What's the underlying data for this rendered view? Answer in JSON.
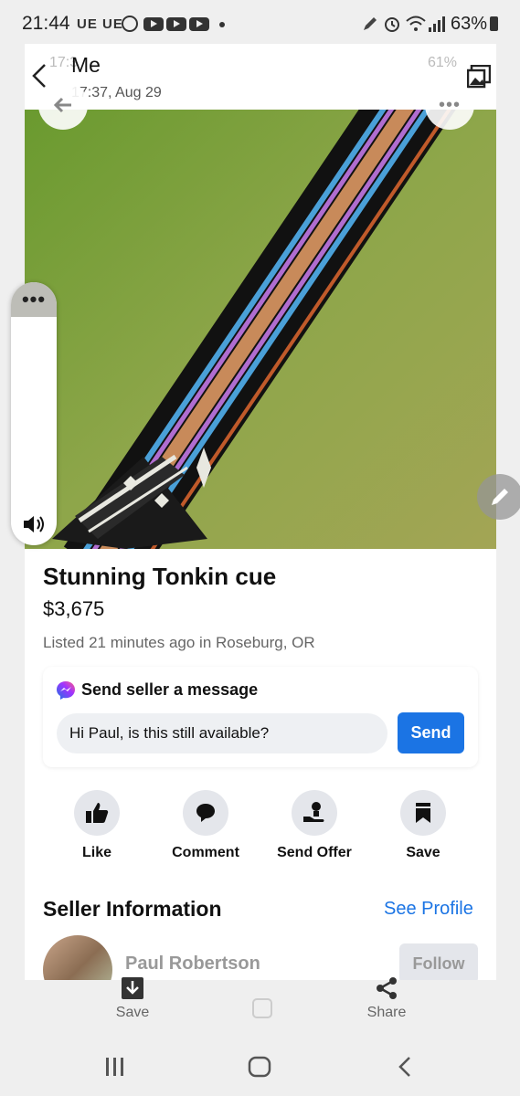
{
  "status_bar": {
    "time": "21:44",
    "carrier": "UE UE",
    "battery": "63%"
  },
  "chat_header": {
    "title": "Me",
    "subtitle": "17:37, Aug 29",
    "ghost_time": "17:3",
    "ghost_battery": "61%"
  },
  "listing": {
    "title": "Stunning Tonkin cue",
    "price": "$3,675",
    "listed": "Listed 21 minutes ago in Roseburg, OR"
  },
  "message": {
    "heading": "Send seller a message",
    "input_value": "Hi Paul, is this still available?",
    "send_label": "Send"
  },
  "actions": [
    {
      "label": "Like",
      "icon": "thumbs-up-icon"
    },
    {
      "label": "Comment",
      "icon": "comment-icon"
    },
    {
      "label": "Send Offer",
      "icon": "send-offer-icon"
    },
    {
      "label": "Save",
      "icon": "bookmark-icon"
    }
  ],
  "seller": {
    "heading": "Seller Information",
    "see_profile": "See Profile",
    "name": "Paul Robertson",
    "follow_label": "Follow"
  },
  "bottom_bar": {
    "save": "Save",
    "share": "Share"
  },
  "colors": {
    "accent": "#1b74e4",
    "messenger": "#a033ff"
  }
}
